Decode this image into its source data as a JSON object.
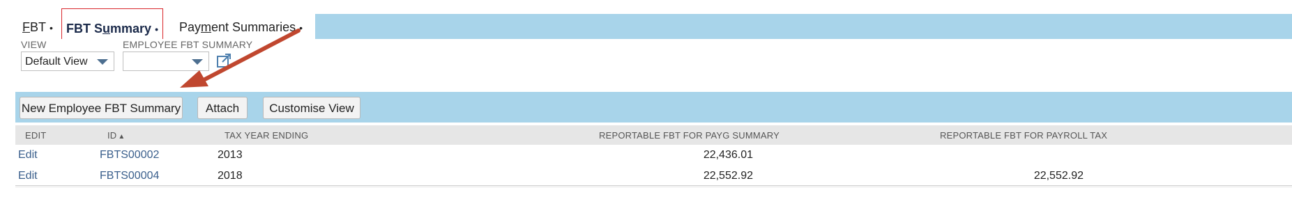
{
  "tabs": [
    {
      "label_prefix": "",
      "label_u": "F",
      "label_rest": "BT"
    },
    {
      "label_prefix": "FBT S",
      "label_u": "u",
      "label_rest": "mmary"
    },
    {
      "label_prefix": "Pay",
      "label_u": "m",
      "label_rest": "ent Summaries"
    }
  ],
  "tab_dot": "•",
  "views": {
    "view_label": "VIEW",
    "view_value": "Default View",
    "employee_label": "EMPLOYEE FBT SUMMARY",
    "employee_value": ""
  },
  "buttons": {
    "new": "New Employee FBT Summary",
    "attach": "Attach",
    "customise": "Customise View"
  },
  "table": {
    "headers": {
      "edit": "EDIT",
      "id": "ID",
      "sort_arrow": "▲",
      "tax_year": "TAX YEAR ENDING",
      "payg": "REPORTABLE FBT FOR PAYG SUMMARY",
      "payroll": "REPORTABLE FBT FOR PAYROLL TAX"
    },
    "rows": [
      {
        "edit": "Edit",
        "id": "FBTS00002",
        "tax_year": "2013",
        "payg": "22,436.01",
        "payroll": ""
      },
      {
        "edit": "Edit",
        "id": "FBTS00004",
        "tax_year": "2018",
        "payg": "22,552.92",
        "payroll": "22,552.92"
      }
    ]
  },
  "colors": {
    "bar": "#a8d4ea",
    "highlight_border": "#d9262b",
    "annotation_arrow": "#c0472f",
    "link": "#3a5f8c"
  }
}
